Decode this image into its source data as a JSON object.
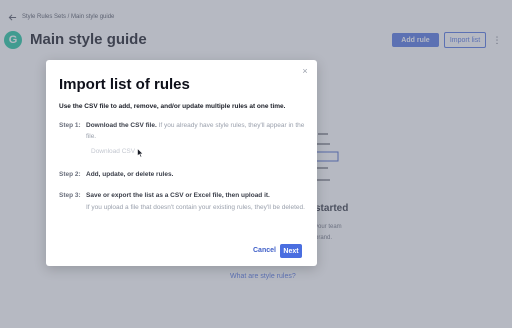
{
  "header": {
    "breadcrumb": "Style Rules Sets / Main style guide",
    "logo_letter": "G",
    "title": "Main style guide",
    "add_rule_label": "Add rule",
    "import_list_label": "Import list",
    "more_icon": "⋮"
  },
  "empty_state": {
    "title": "started",
    "description_line1": "your team",
    "description_line2": "brand.",
    "link_label": "What are style rules?"
  },
  "modal": {
    "title": "Import list of rules",
    "subtitle": "Use the CSV file to add, remove, and/or update multiple rules at one time.",
    "close_icon": "×",
    "steps": [
      {
        "label": "Step 1:",
        "head": "Download the CSV file.",
        "desc": " If you already have style rules, they'll appear in the file."
      },
      {
        "label": "Step 2:",
        "head": "Add, update, or delete rules.",
        "desc": ""
      },
      {
        "label": "Step 3:",
        "head": "Save or export the list as a CSV or Excel file, then upload it.",
        "desc": "If you upload a file that doesn't contain your existing rules, they'll be deleted."
      }
    ],
    "download_label": "Download CSV",
    "cancel_label": "Cancel",
    "next_label": "Next"
  },
  "colors": {
    "accent": "#4a6ee0",
    "logo": "#15c39a",
    "overlay": "rgba(110,116,134,0.5)"
  }
}
